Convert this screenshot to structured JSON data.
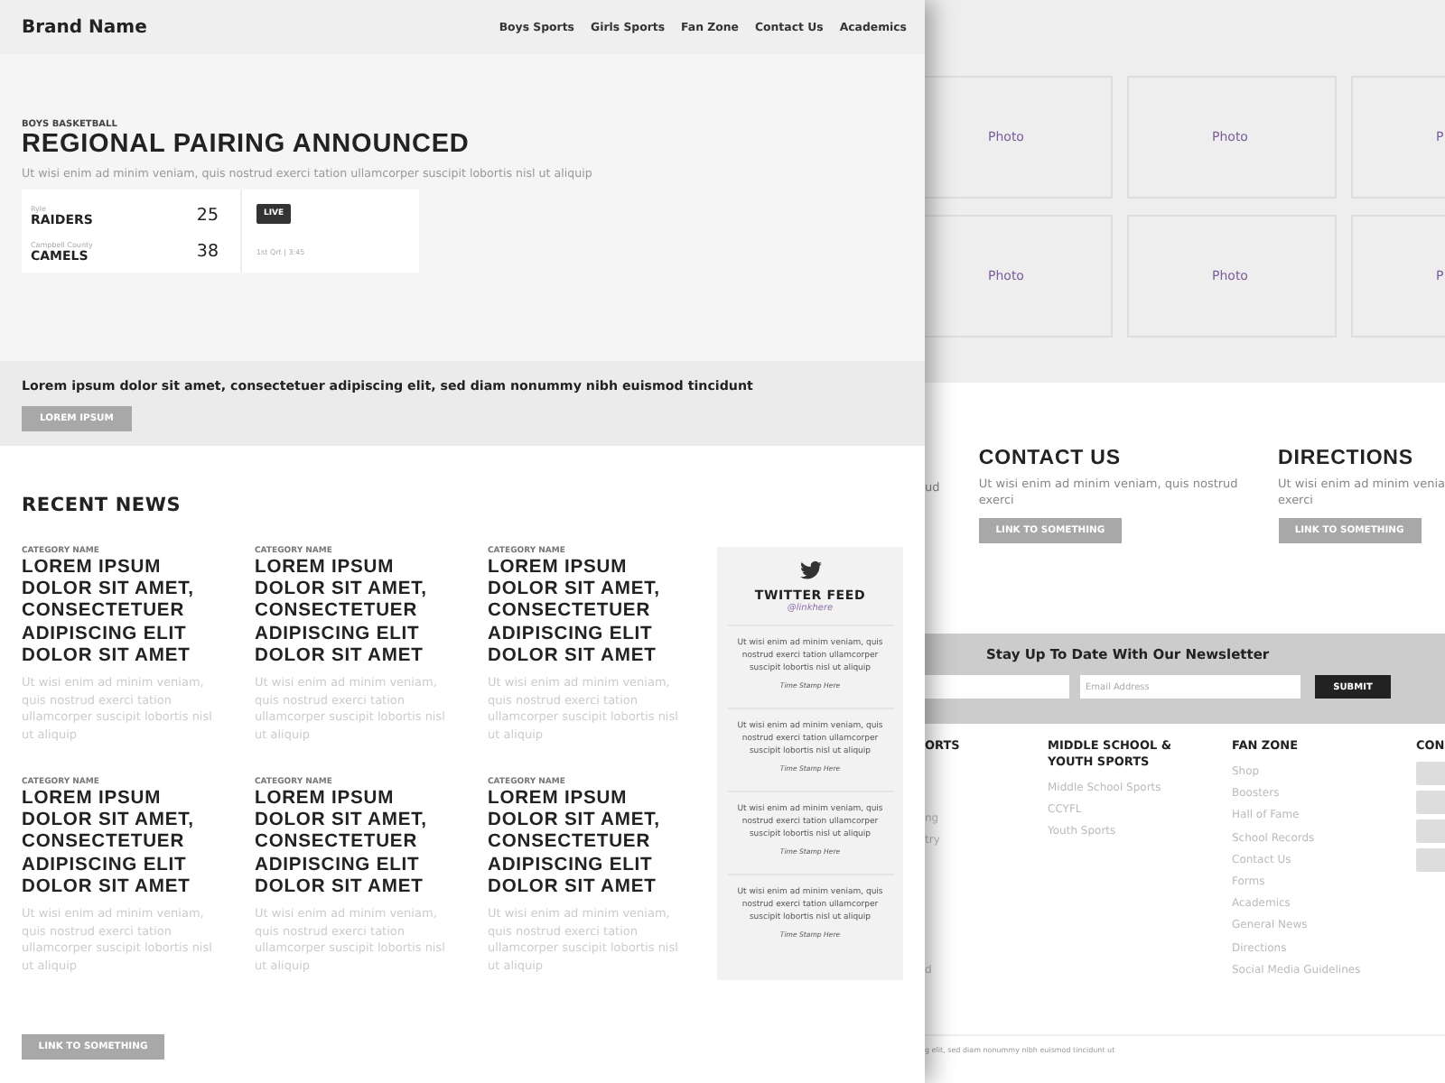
{
  "front_page": {
    "header": {
      "brand": "Brand Name",
      "nav": [
        "Boys Sports",
        "Girls Sports",
        "Fan Zone",
        "Contact Us",
        "Academics"
      ]
    },
    "hero": {
      "category": "BOYS BASKETBALL",
      "title": "REGIONAL PAIRING ANNOUNCED",
      "subtitle": "Ut wisi enim ad minim veniam, quis nostrud exerci tation ullamcorper suscipit lobortis nisl ut aliquip",
      "scoreboard": {
        "teams": [
          {
            "school": "Ryle",
            "name": "RAIDERS",
            "score": "25"
          },
          {
            "school": "Campbell County",
            "name": "CAMELS",
            "score": "38"
          }
        ],
        "status": "LIVE",
        "period": "1st Qrt | 3:45"
      }
    },
    "banner": {
      "text": "Lorem ipsum dolor sit amet, consectetuer adipiscing elit, sed diam nonummy nibh euismod tincidunt",
      "button": "LOREM IPSUM"
    },
    "recent_news": {
      "title": "RECENT NEWS",
      "articles": [
        {
          "category": "CATEGORY NAME",
          "headline": "LOREM IPSUM DOLOR SIT AMET, CONSECTETUER ADIPISCING ELIT DOLOR SIT AMET",
          "summary": "Ut wisi enim ad minim veniam, quis nostrud exerci tation ullamcorper suscipit lobortis nisl ut aliquip"
        },
        {
          "category": "CATEGORY NAME",
          "headline": "LOREM IPSUM DOLOR SIT AMET, CONSECTETUER ADIPISCING ELIT DOLOR SIT AMET",
          "summary": "Ut wisi enim ad minim veniam, quis nostrud exerci tation ullamcorper suscipit lobortis nisl ut aliquip"
        },
        {
          "category": "CATEGORY NAME",
          "headline": "LOREM IPSUM DOLOR SIT AMET, CONSECTETUER ADIPISCING ELIT DOLOR SIT AMET",
          "summary": "Ut wisi enim ad minim veniam, quis nostrud exerci tation ullamcorper suscipit lobortis nisl ut aliquip"
        },
        {
          "category": "CATEGORY NAME",
          "headline": "LOREM IPSUM DOLOR SIT AMET, CONSECTETUER ADIPISCING ELIT DOLOR SIT AMET",
          "summary": "Ut wisi enim ad minim veniam, quis nostrud exerci tation ullamcorper suscipit lobortis nisl ut aliquip"
        },
        {
          "category": "CATEGORY NAME",
          "headline": "LOREM IPSUM DOLOR SIT AMET, CONSECTETUER ADIPISCING ELIT DOLOR SIT AMET",
          "summary": "Ut wisi enim ad minim veniam, quis nostrud exerci tation ullamcorper suscipit lobortis nisl ut aliquip"
        },
        {
          "category": "CATEGORY NAME",
          "headline": "LOREM IPSUM DOLOR SIT AMET, CONSECTETUER ADIPISCING ELIT DOLOR SIT AMET",
          "summary": "Ut wisi enim ad minim veniam, quis nostrud exerci tation ullamcorper suscipit lobortis nisl ut aliquip"
        }
      ],
      "button": "LINK TO SOMETHING"
    },
    "twitter_feed": {
      "title": "TWITTER FEED",
      "handle": "@linkhere",
      "tweets": [
        {
          "text": "Ut wisi enim ad minim veniam, quis nostrud exerci tation ullamcorper suscipit lobortis nisl ut aliquip",
          "timestamp": "Time Stamp Here"
        },
        {
          "text": "Ut wisi enim ad minim veniam, quis nostrud exerci tation ullamcorper suscipit lobortis nisl ut aliquip",
          "timestamp": "Time Stamp Here"
        },
        {
          "text": "Ut wisi enim ad minim veniam, quis nostrud exerci tation ullamcorper suscipit lobortis nisl ut aliquip",
          "timestamp": "Time Stamp Here"
        },
        {
          "text": "Ut wisi enim ad minim veniam, quis nostrud exerci tation ullamcorper suscipit lobortis nisl ut aliquip",
          "timestamp": "Time Stamp Here"
        }
      ]
    }
  },
  "back_page": {
    "photos": [
      "Photo",
      "Photo",
      "P",
      "Photo",
      "Photo",
      "P"
    ],
    "info_columns": [
      {
        "lines": [
          "ud"
        ]
      },
      {
        "title": "CONTACT US",
        "lines": [
          "Ut wisi enim ad minim veniam, quis nostrud",
          "exerci"
        ],
        "button": "LINK TO SOMETHING"
      },
      {
        "title": "DIRECTIONS",
        "lines": [
          "Ut wisi enim ad minim venia",
          "exerci"
        ],
        "button": "LINK TO SOMETHING"
      }
    ],
    "newsletter": {
      "title": "Stay Up To Date With Our Newsletter",
      "email_placeholder": "Email Address",
      "button": "SUBMIT"
    },
    "footer_columns": [
      {
        "title": "ORTS",
        "links": [
          "ng",
          "try",
          "d"
        ]
      },
      {
        "title": "MIDDLE SCHOOL & YOUTH SPORTS",
        "links": [
          "Middle School Sports",
          "CCYFL",
          "Youth Sports"
        ]
      },
      {
        "title": "FAN ZONE",
        "links": [
          "Shop",
          "Boosters",
          "Hall of Fame",
          "School Records",
          "Contact Us",
          "Forms",
          "Academics",
          "General News",
          "Directions",
          "Social Media Guidelines"
        ]
      },
      {
        "title": "CON",
        "kind": "social"
      }
    ],
    "copyright": "g elit, sed diam nonummy nibh euismod tincidunt ut"
  }
}
